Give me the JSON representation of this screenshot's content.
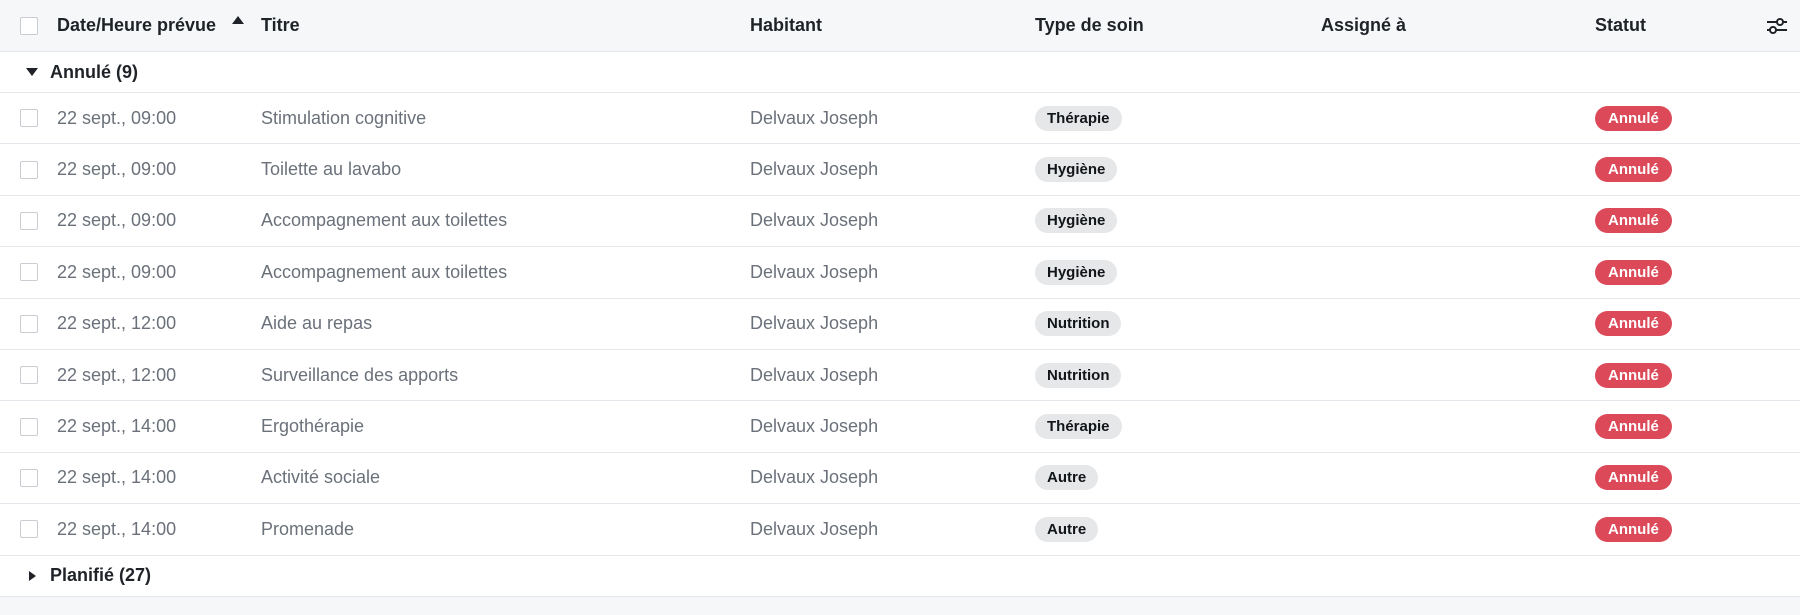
{
  "header": {
    "date": "Date/Heure prévue",
    "title": "Titre",
    "resident": "Habitant",
    "care_type": "Type de soin",
    "assigned": "Assigné à",
    "status": "Statut"
  },
  "groups": [
    {
      "label": "Annulé (9)",
      "expanded": true
    },
    {
      "label": "Planifié (27)",
      "expanded": false
    }
  ],
  "rows": [
    {
      "date": "22 sept., 09:00",
      "title": "Stimulation cognitive",
      "resident": "Delvaux Joseph",
      "care_type": "Thérapie",
      "assigned": "",
      "status": "Annulé"
    },
    {
      "date": "22 sept., 09:00",
      "title": "Toilette au lavabo",
      "resident": "Delvaux Joseph",
      "care_type": "Hygiène",
      "assigned": "",
      "status": "Annulé"
    },
    {
      "date": "22 sept., 09:00",
      "title": "Accompagnement aux toilettes",
      "resident": "Delvaux Joseph",
      "care_type": "Hygiène",
      "assigned": "",
      "status": "Annulé"
    },
    {
      "date": "22 sept., 09:00",
      "title": "Accompagnement aux toilettes",
      "resident": "Delvaux Joseph",
      "care_type": "Hygiène",
      "assigned": "",
      "status": "Annulé"
    },
    {
      "date": "22 sept., 12:00",
      "title": "Aide au repas",
      "resident": "Delvaux Joseph",
      "care_type": "Nutrition",
      "assigned": "",
      "status": "Annulé"
    },
    {
      "date": "22 sept., 12:00",
      "title": "Surveillance des apports",
      "resident": "Delvaux Joseph",
      "care_type": "Nutrition",
      "assigned": "",
      "status": "Annulé"
    },
    {
      "date": "22 sept., 14:00",
      "title": "Ergothérapie",
      "resident": "Delvaux Joseph",
      "care_type": "Thérapie",
      "assigned": "",
      "status": "Annulé"
    },
    {
      "date": "22 sept., 14:00",
      "title": "Activité sociale",
      "resident": "Delvaux Joseph",
      "care_type": "Autre",
      "assigned": "",
      "status": "Annulé"
    },
    {
      "date": "22 sept., 14:00",
      "title": "Promenade",
      "resident": "Delvaux Joseph",
      "care_type": "Autre",
      "assigned": "",
      "status": "Annulé"
    }
  ],
  "icons": {
    "sort": "sort-ascending-icon",
    "settings": "sliders-icon",
    "expand": "caret-down-icon",
    "collapse": "caret-right-icon"
  },
  "colors": {
    "status_cancelled": "#dc4a59",
    "tag_bg": "#e6e7e9",
    "header_bg": "#f6f7f9"
  }
}
